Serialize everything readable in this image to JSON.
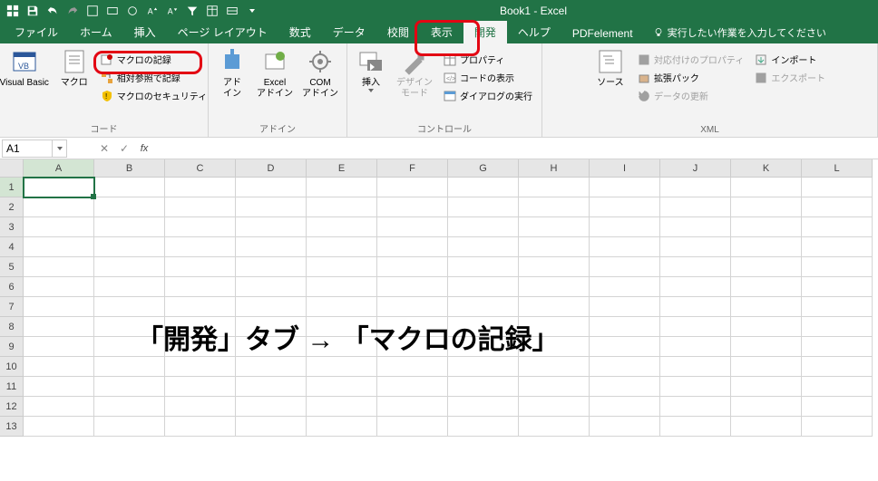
{
  "title": "Book1 - Excel",
  "tabs": [
    "ファイル",
    "ホーム",
    "挿入",
    "ページ レイアウト",
    "数式",
    "データ",
    "校閲",
    "表示",
    "開発",
    "ヘルプ",
    "PDFelement"
  ],
  "tellme": "実行したい作業を入力してください",
  "ribbon": {
    "code": {
      "vb": "Visual Basic",
      "macro": "マクロ",
      "record": "マクロの記録",
      "relref": "相対参照で記録",
      "security": "マクロのセキュリティ",
      "label": "コード"
    },
    "addins": {
      "addin": "アド\nイン",
      "excel": "Excel\nアドイン",
      "com": "COM\nアドイン",
      "label": "アドイン"
    },
    "controls": {
      "insert": "挿入",
      "design": "デザイン\nモード",
      "props": "プロパティ",
      "viewcode": "コードの表示",
      "rundialog": "ダイアログの実行",
      "label": "コントロール"
    },
    "xml": {
      "source": "ソース",
      "mapprops": "対応付けのプロパティ",
      "exp_pack": "拡張パック",
      "refresh": "データの更新",
      "import": "インポート",
      "export": "エクスポート",
      "label": "XML"
    }
  },
  "namebox": "A1",
  "cols": [
    "A",
    "B",
    "C",
    "D",
    "E",
    "F",
    "G",
    "H",
    "I",
    "J",
    "K",
    "L"
  ],
  "rows": [
    "1",
    "2",
    "3",
    "4",
    "5",
    "6",
    "7",
    "8",
    "9",
    "10",
    "11",
    "12",
    "13"
  ],
  "annotation_text": "「開発」タブ → 「マクロの記録」"
}
